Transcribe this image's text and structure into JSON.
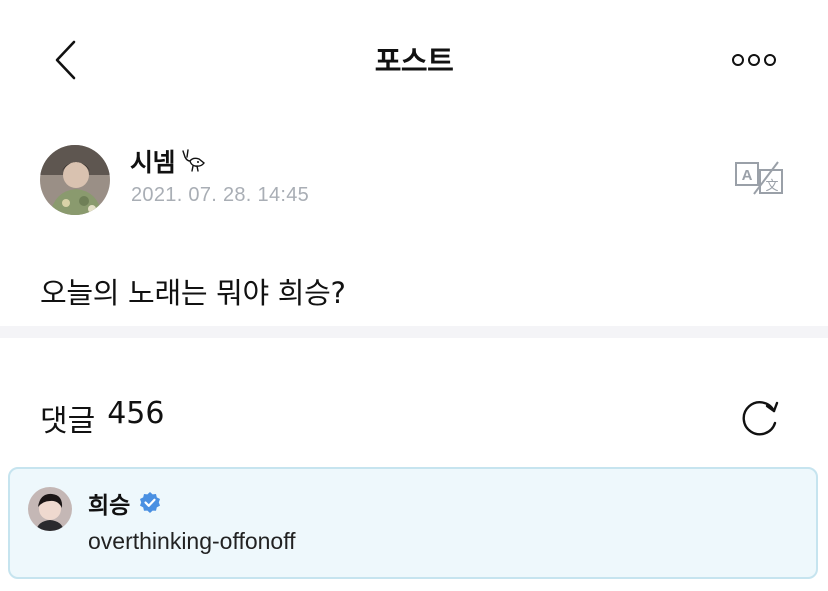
{
  "header": {
    "title": "포스트",
    "back_icon": "chevron-left-icon",
    "more_icon": "more-options-icon"
  },
  "post": {
    "author": "시넴",
    "author_emoji": "deer-antler-doodle-icon",
    "timestamp": "2021. 07. 28. 14:45",
    "text": "오늘의 노래는 뭐야 희승?",
    "translate_icon": "translate-icon"
  },
  "comments": {
    "label": "댓글",
    "count": "456",
    "refresh_icon": "refresh-icon"
  },
  "highlighted_reply": {
    "author": "희승",
    "verified_icon": "verified-badge-icon",
    "text": "overthinking-offonoff",
    "accent_color": "#4a90e2",
    "background_color": "#eef8fc"
  }
}
